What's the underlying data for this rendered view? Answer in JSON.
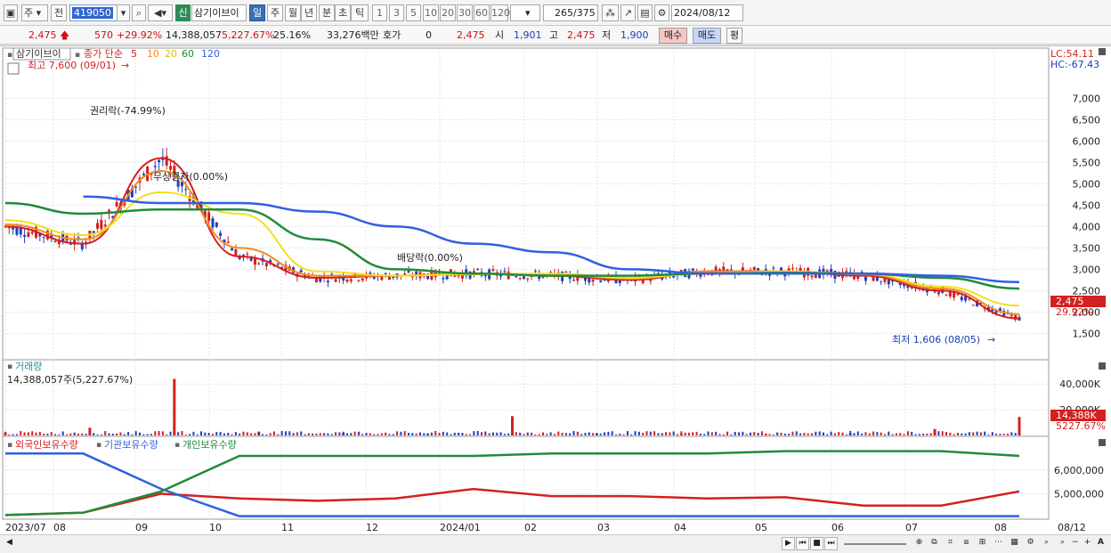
{
  "toolbar": {
    "market": "주",
    "type": "전",
    "code": "419050",
    "new_badge": "신",
    "stock_name": "삼기이브이",
    "periods": [
      "일",
      "주",
      "월",
      "년",
      "분",
      "초",
      "틱"
    ],
    "intervals": [
      "1",
      "3",
      "5",
      "10",
      "20",
      "30",
      "60",
      "120"
    ],
    "count": "265",
    "total": "/375",
    "date": "2024/08/12"
  },
  "infobar": {
    "price": "2,475",
    "change": "570",
    "change_pct": "+29.92%",
    "volume": "14,388,057",
    "volume_pct": "5,227.67%",
    "turnover": "25.16%",
    "amount": "33,276백만",
    "quote_label": "호가",
    "quote_val": "0",
    "price2": "2,475",
    "open_label": "시",
    "open": "1,901",
    "high_label": "고",
    "high": "2,475",
    "low_label": "저",
    "low": "1,900",
    "buy": "매수",
    "sell": "매도",
    "eval": "평"
  },
  "price_panel": {
    "title": "삼기이브이",
    "ma_label": "종가 단순",
    "ma_periods": [
      "5",
      "10",
      "20",
      "60",
      "120"
    ],
    "max_label": "최고 7,600 (09/01)",
    "min_label": "최저 1,606 (08/05)",
    "annotations": [
      "권리락(-74.99%)",
      "무상증자(0.00%)",
      "배당락(0.00%)"
    ],
    "lc": "LC:54.11",
    "hc": "HC:-67.43",
    "current_price": "2,475",
    "current_pct": "29.92%"
  },
  "volume_panel": {
    "title": "거래량",
    "sub": "14,388,057주(5,227.67%)",
    "last_vol": "14,388K",
    "last_pct": "5227.67%"
  },
  "holding_panel": {
    "series_labels": [
      "외국인보유수량",
      "기관보유수량",
      "개인보유수량"
    ]
  },
  "x_labels": [
    "2023/07",
    "08",
    "09",
    "10",
    "11",
    "12",
    "2024/01",
    "02",
    "03",
    "04",
    "05",
    "06",
    "07",
    "08",
    "08/12"
  ],
  "colors": {
    "ma5": "#d42020",
    "ma10": "#f28c1e",
    "ma20": "#f0e020",
    "ma60": "#228b3a",
    "ma120": "#3060e0",
    "up": "#d42020",
    "down": "#1f3fbf"
  },
  "chart_data": [
    {
      "type": "line",
      "title": "삼기이브이",
      "x": [
        "2023/07",
        "08",
        "09",
        "10",
        "11",
        "12",
        "2024/01",
        "02",
        "03",
        "04",
        "05",
        "06",
        "07",
        "08"
      ],
      "series": [
        {
          "name": "5",
          "values": [
            4000,
            3600,
            5600,
            3300,
            2800,
            2850,
            2900,
            2850,
            2750,
            2950,
            2950,
            2850,
            2500,
            1850
          ]
        },
        {
          "name": "10",
          "values": [
            4050,
            3700,
            5300,
            3500,
            2850,
            2850,
            2900,
            2880,
            2780,
            2950,
            2950,
            2880,
            2550,
            1950
          ]
        },
        {
          "name": "20",
          "values": [
            4150,
            3800,
            4800,
            4300,
            2950,
            2850,
            2880,
            2900,
            2800,
            2900,
            2950,
            2900,
            2600,
            2150
          ]
        },
        {
          "name": "60",
          "values": [
            4550,
            4300,
            4400,
            4400,
            3700,
            3000,
            2900,
            2850,
            2850,
            2900,
            2920,
            2900,
            2800,
            2550
          ]
        },
        {
          "name": "120",
          "values": [
            null,
            4700,
            4550,
            4550,
            4350,
            4000,
            3600,
            3400,
            3000,
            2900,
            2900,
            2900,
            2850,
            2700
          ]
        }
      ],
      "ylim": [
        1300,
        7800
      ],
      "yticks": [
        "1,500",
        "2,000",
        "2,500",
        "3,000",
        "3,500",
        "4,000",
        "4,500",
        "5,000",
        "5,500",
        "6,000",
        "6,500",
        "7,000"
      ]
    },
    {
      "type": "bar",
      "title": "거래량",
      "ylim": [
        0,
        45000
      ],
      "yticks": [
        "20,000K",
        "40,000K"
      ],
      "values": [
        2000,
        6000,
        44000,
        3000,
        1500,
        1200,
        15000,
        1800,
        1200,
        1000,
        1500,
        5000,
        14388
      ]
    },
    {
      "type": "line",
      "series": [
        {
          "name": "외국인보유수량",
          "values": [
            4100000,
            4200000,
            5000000,
            4800000,
            4700000,
            4800000,
            5200000,
            4900000,
            4900000,
            4800000,
            4850000,
            4500000,
            4500000,
            5100000
          ]
        },
        {
          "name": "기관보유수량",
          "values": [
            6700000,
            6700000,
            5200000,
            4050000,
            4050000,
            4050000,
            4050000,
            4050000,
            4050000,
            4050000,
            4050000,
            4050000,
            4050000,
            4050000
          ]
        },
        {
          "name": "개인보유수량",
          "values": [
            4100000,
            4200000,
            5100000,
            6600000,
            6600000,
            6600000,
            6600000,
            6700000,
            6700000,
            6700000,
            6800000,
            6800000,
            6800000,
            6600000
          ]
        }
      ],
      "yticks": [
        "5,000,000",
        "6,000,000"
      ]
    }
  ]
}
